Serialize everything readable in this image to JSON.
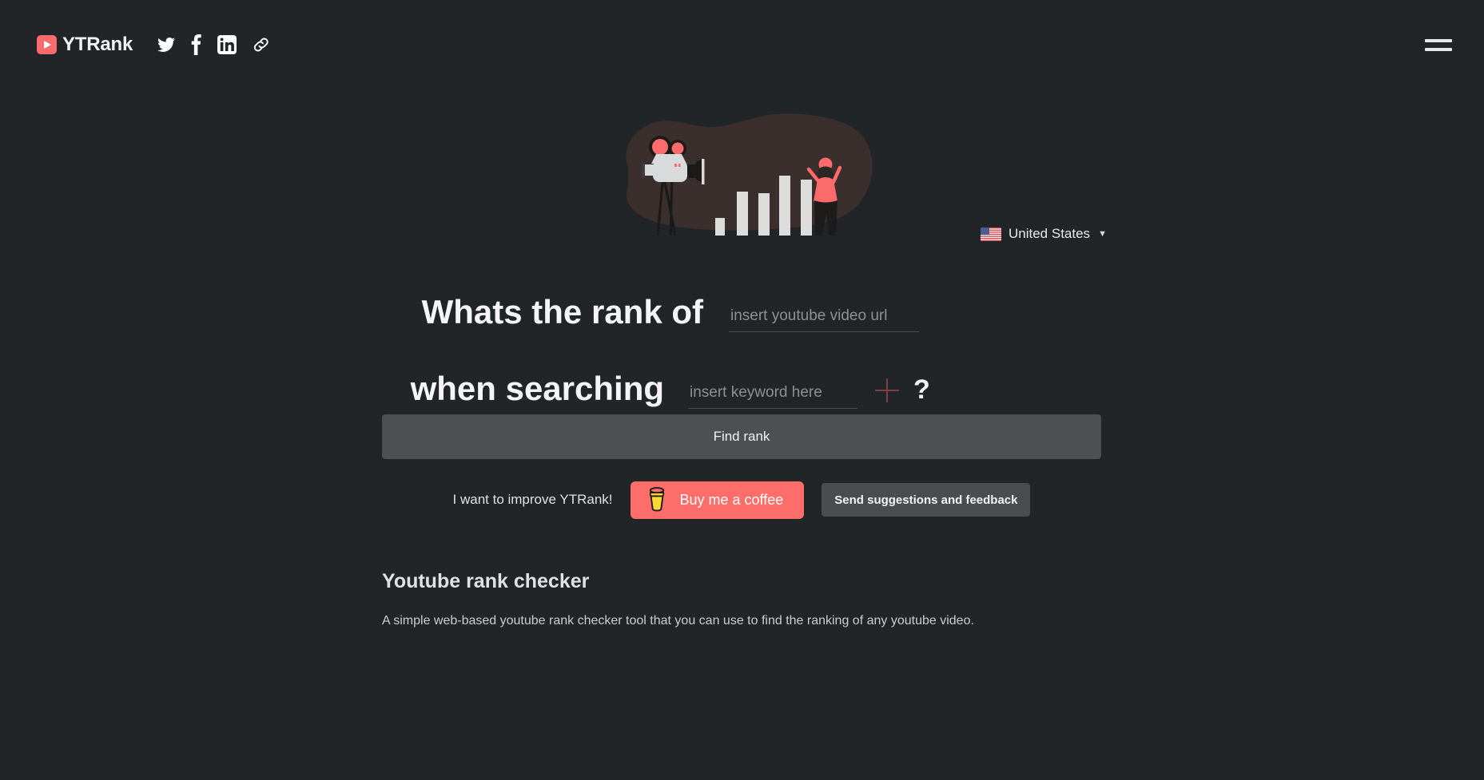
{
  "app": {
    "brand_name": "YTRank",
    "background_color": "#222527",
    "accent_color": "#fd6e6a"
  },
  "header": {
    "logo_icon": "youtube-play-icon",
    "social_links": [
      {
        "name": "twitter-icon",
        "label": "Twitter"
      },
      {
        "name": "facebook-icon",
        "label": "Facebook"
      },
      {
        "name": "linkedin-icon",
        "label": "LinkedIn"
      },
      {
        "name": "link-icon",
        "label": "Copy link"
      }
    ],
    "menu_icon": "hamburger-menu-icon"
  },
  "illustration": {
    "name": "video-camera-analytics-illustration",
    "blob_color": "#3b2f2d",
    "bar_color": "#dcdcdc",
    "person_shirt_color": "#f96e6a",
    "camera_body_color": "#d9dadc",
    "lens_color": "#fb6b6b",
    "bars": [
      14,
      52,
      46,
      74,
      64
    ]
  },
  "country_selector": {
    "flag_icon": "us-flag-icon",
    "label": "United States",
    "caret_icon": "chevron-down-icon"
  },
  "search": {
    "prefix_line1": "Whats the rank of",
    "prefix_line2": "when searching",
    "url_value": "",
    "url_placeholder": "insert youtube video url",
    "keyword_value": "",
    "keyword_placeholder": "insert keyword here",
    "add_keyword_icon": "plus-icon",
    "question_mark": "?",
    "submit_label": "Find rank"
  },
  "support": {
    "message": "I want to improve YTRank!",
    "coffee_label": "Buy me a coffee",
    "coffee_icon": "coffee-cup-icon",
    "feedback_label": "Send suggestions and feedback"
  },
  "article": {
    "heading": "Youtube rank checker",
    "body": "A simple web-based youtube rank checker tool that you can use to find the ranking of any youtube video."
  }
}
